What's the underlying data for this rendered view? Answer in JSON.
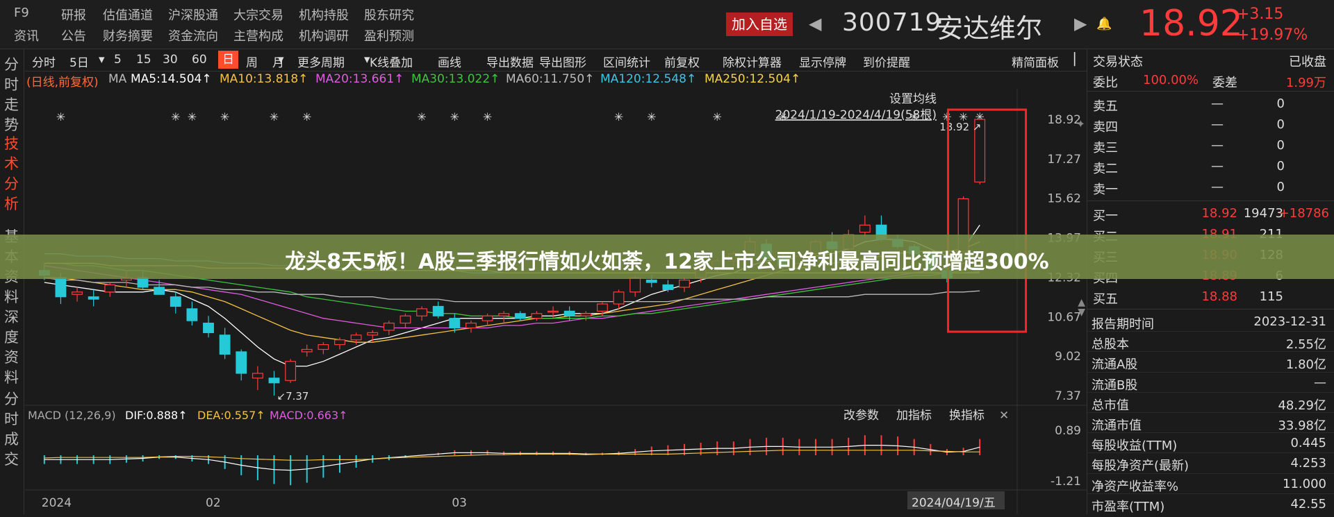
{
  "header": {
    "menu_row1": [
      "F9",
      "研报",
      "估值通道",
      "沪深股通",
      "大宗交易",
      "机构持股",
      "股东研究"
    ],
    "menu_row2": [
      "资讯",
      "公告",
      "财务摘要",
      "资金流向",
      "主营构成",
      "机构调研",
      "盈利预测"
    ],
    "add_favorite": "加入自选",
    "stock_code": "300719",
    "stock_name": "安达维尔",
    "last_price": "18.92",
    "change": "+3.15",
    "change_pct": "+19.97%"
  },
  "left_nav": [
    {
      "label": "分时走势",
      "active": false
    },
    {
      "label": "技术分析",
      "active": true
    },
    {
      "label": "基本资料",
      "active": false
    },
    {
      "label": "深度资料",
      "active": false
    },
    {
      "label": "分时成交",
      "active": false
    }
  ],
  "toolbar": {
    "periods": [
      "分时",
      "5日",
      "5",
      "15",
      "30",
      "60",
      "日",
      "周",
      "月"
    ],
    "active_period": "日",
    "tools": [
      "更多周期",
      "K线叠加",
      "画线",
      "导出数据",
      "导出图形",
      "区间统计",
      "前复权",
      "除权计算器",
      "显示停牌",
      "到价提醒"
    ],
    "layout_button": "精简面板"
  },
  "ma_line": {
    "prefix": "(日线,前复权)",
    "ma": "MA",
    "items": [
      {
        "text": "MA5:14.504↑",
        "color": "#ffffff"
      },
      {
        "text": "MA10:13.818↑",
        "color": "#f5c242"
      },
      {
        "text": "MA20:13.661↑",
        "color": "#e05ce0"
      },
      {
        "text": "MA30:13.022↑",
        "color": "#3ec43e"
      },
      {
        "text": "MA60:11.750↑",
        "color": "#bbbbbb"
      },
      {
        "text": "MA120:12.548↑",
        "color": "#39c6e6"
      },
      {
        "text": "MA250:12.504↑",
        "color": "#f5d442"
      }
    ],
    "settings_label": "设置均线",
    "range_label": "2024/1/19-2024/4/19(58根)"
  },
  "chart_data": {
    "type": "candlestick",
    "price_axis": [
      18.92,
      17.27,
      15.62,
      13.97,
      12.32,
      10.67,
      9.02,
      7.37
    ],
    "ylim": [
      7.37,
      18.92
    ],
    "high_label": "18.92",
    "low_label": "7.37",
    "ohlc": [
      [
        12.6,
        12.9,
        12.2,
        12.4
      ],
      [
        12.3,
        12.5,
        11.2,
        11.5
      ],
      [
        11.6,
        11.9,
        11.3,
        11.7
      ],
      [
        11.5,
        11.8,
        11.1,
        11.4
      ],
      [
        11.7,
        12.1,
        11.5,
        12.0
      ],
      [
        12.2,
        12.6,
        11.9,
        12.3
      ],
      [
        12.3,
        12.6,
        11.8,
        11.9
      ],
      [
        11.9,
        12.2,
        11.6,
        11.6
      ],
      [
        11.5,
        11.7,
        10.8,
        11.1
      ],
      [
        11.0,
        11.3,
        10.3,
        10.5
      ],
      [
        10.4,
        10.7,
        9.8,
        10.0
      ],
      [
        9.9,
        10.2,
        8.9,
        9.1
      ],
      [
        9.2,
        9.3,
        8.0,
        8.3
      ],
      [
        8.1,
        8.6,
        7.6,
        8.3
      ],
      [
        8.1,
        8.4,
        7.37,
        7.9
      ],
      [
        8.0,
        8.9,
        7.9,
        8.8
      ],
      [
        9.2,
        9.5,
        9.0,
        9.3
      ],
      [
        9.3,
        9.6,
        9.1,
        9.5
      ],
      [
        9.5,
        9.8,
        9.3,
        9.7
      ],
      [
        9.7,
        10.0,
        9.5,
        9.9
      ],
      [
        9.9,
        10.1,
        9.6,
        10.0
      ],
      [
        10.1,
        10.5,
        9.9,
        10.4
      ],
      [
        10.4,
        10.8,
        10.2,
        10.7
      ],
      [
        10.7,
        11.1,
        10.5,
        11.0
      ],
      [
        11.1,
        11.3,
        10.6,
        10.7
      ],
      [
        10.6,
        10.8,
        10.0,
        10.2
      ],
      [
        10.2,
        10.5,
        10.0,
        10.4
      ],
      [
        10.5,
        10.8,
        10.3,
        10.7
      ],
      [
        10.7,
        10.9,
        10.4,
        10.8
      ],
      [
        10.8,
        10.9,
        10.5,
        10.6
      ],
      [
        10.6,
        10.9,
        10.5,
        10.8
      ],
      [
        10.9,
        11.1,
        10.6,
        10.9
      ],
      [
        10.9,
        11.1,
        10.5,
        10.7
      ],
      [
        10.7,
        10.9,
        10.5,
        10.8
      ],
      [
        10.9,
        11.3,
        10.7,
        11.2
      ],
      [
        11.2,
        11.8,
        11.0,
        11.7
      ],
      [
        11.7,
        12.4,
        11.5,
        12.3
      ],
      [
        12.2,
        12.4,
        11.9,
        12.1
      ],
      [
        12.0,
        12.2,
        11.7,
        11.8
      ],
      [
        11.9,
        12.3,
        11.7,
        12.2
      ],
      [
        12.3,
        12.8,
        12.1,
        12.7
      ],
      [
        12.7,
        13.1,
        12.5,
        13.0
      ],
      [
        13.0,
        13.4,
        12.8,
        13.3
      ],
      [
        13.3,
        14.0,
        13.1,
        13.8
      ],
      [
        13.7,
        13.9,
        12.9,
        13.1
      ],
      [
        13.1,
        13.3,
        12.6,
        12.8
      ],
      [
        12.9,
        13.4,
        12.6,
        13.2
      ],
      [
        13.3,
        13.9,
        13.1,
        13.8
      ],
      [
        13.8,
        14.2,
        13.4,
        13.5
      ],
      [
        13.5,
        14.3,
        13.3,
        14.1
      ],
      [
        14.2,
        14.9,
        14.0,
        14.5
      ],
      [
        14.5,
        14.9,
        13.8,
        13.9
      ],
      [
        13.9,
        14.1,
        13.5,
        13.6
      ],
      [
        13.6,
        13.7,
        13.2,
        13.3
      ],
      [
        13.3,
        13.4,
        12.5,
        12.6
      ],
      [
        12.6,
        12.8,
        12.1,
        12.3
      ],
      [
        13.4,
        15.7,
        13.3,
        15.6
      ],
      [
        16.3,
        18.92,
        16.2,
        18.92
      ]
    ],
    "ma_series": [
      {
        "name": "MA5",
        "color": "#ffffff",
        "values": [
          12.1,
          12.0,
          11.9,
          11.8,
          11.7,
          11.7,
          11.7,
          11.8,
          11.7,
          11.4,
          11.1,
          10.6,
          10.0,
          9.4,
          8.9,
          8.6,
          8.6,
          8.8,
          9.1,
          9.4,
          9.7,
          9.8,
          10.0,
          10.2,
          10.4,
          10.6,
          10.6,
          10.6,
          10.6,
          10.6,
          10.7,
          10.7,
          10.8,
          10.8,
          10.8,
          11.0,
          11.3,
          11.6,
          11.8,
          12.0,
          12.2,
          12.4,
          12.5,
          12.8,
          13.0,
          13.1,
          13.1,
          13.2,
          13.3,
          13.5,
          13.8,
          13.9,
          13.9,
          13.8,
          13.5,
          13.2,
          13.5,
          14.5
        ]
      },
      {
        "name": "MA10",
        "color": "#f5c242",
        "values": [
          12.3,
          12.3,
          12.2,
          12.1,
          12.0,
          11.9,
          11.8,
          11.8,
          11.8,
          11.7,
          11.5,
          11.3,
          11.0,
          10.7,
          10.4,
          10.1,
          9.9,
          9.8,
          9.7,
          9.6,
          9.6,
          9.7,
          9.8,
          9.9,
          10.0,
          10.1,
          10.2,
          10.3,
          10.4,
          10.5,
          10.6,
          10.6,
          10.7,
          10.7,
          10.8,
          10.9,
          11.0,
          11.1,
          11.2,
          11.4,
          11.6,
          11.8,
          12.0,
          12.2,
          12.4,
          12.6,
          12.7,
          12.8,
          12.9,
          13.0,
          13.1,
          13.2,
          13.3,
          13.4,
          13.4,
          13.4,
          13.5,
          13.8
        ]
      },
      {
        "name": "MA20",
        "color": "#e05ce0",
        "values": [
          12.8,
          12.7,
          12.6,
          12.5,
          12.4,
          12.3,
          12.2,
          12.1,
          12.0,
          11.9,
          11.8,
          11.7,
          11.6,
          11.4,
          11.2,
          11.0,
          10.8,
          10.6,
          10.5,
          10.4,
          10.3,
          10.2,
          10.2,
          10.2,
          10.2,
          10.2,
          10.2,
          10.2,
          10.3,
          10.3,
          10.4,
          10.4,
          10.5,
          10.6,
          10.6,
          10.7,
          10.8,
          10.9,
          11.0,
          11.1,
          11.2,
          11.3,
          11.4,
          11.5,
          11.6,
          11.7,
          11.8,
          11.9,
          12.0,
          12.1,
          12.2,
          12.3,
          12.4,
          12.5,
          12.6,
          12.7,
          12.9,
          13.2
        ]
      },
      {
        "name": "MA30",
        "color": "#3ec43e",
        "values": [
          12.9,
          12.9,
          12.8,
          12.8,
          12.7,
          12.6,
          12.6,
          12.5,
          12.4,
          12.3,
          12.2,
          12.1,
          12.0,
          11.9,
          11.8,
          11.7,
          11.5,
          11.4,
          11.3,
          11.2,
          11.1,
          11.0,
          10.9,
          10.9,
          10.8,
          10.8,
          10.7,
          10.7,
          10.7,
          10.6,
          10.6,
          10.6,
          10.6,
          10.6,
          10.7,
          10.7,
          10.8,
          10.8,
          10.9,
          11.0,
          11.1,
          11.2,
          11.3,
          11.4,
          11.5,
          11.6,
          11.7,
          11.8,
          11.9,
          12.0,
          12.1,
          12.2,
          12.3,
          12.4,
          12.4,
          12.5,
          12.6,
          12.8
        ]
      },
      {
        "name": "MA60",
        "color": "#bbbbbb",
        "values": [
          12.3,
          12.2,
          12.2,
          12.1,
          12.1,
          12.1,
          12.0,
          12.0,
          12.0,
          11.9,
          11.9,
          11.8,
          11.8,
          11.7,
          11.7,
          11.6,
          11.6,
          11.6,
          11.5,
          11.5,
          11.5,
          11.4,
          11.4,
          11.4,
          11.4,
          11.3,
          11.3,
          11.3,
          11.3,
          11.3,
          11.3,
          11.3,
          11.3,
          11.3,
          11.3,
          11.3,
          11.3,
          11.3,
          11.3,
          11.4,
          11.4,
          11.4,
          11.4,
          11.4,
          11.5,
          11.5,
          11.5,
          11.5,
          11.5,
          11.5,
          11.6,
          11.6,
          11.6,
          11.6,
          11.6,
          11.7,
          11.7,
          11.75
        ]
      },
      {
        "name": "MA120",
        "color": "#39c6e6",
        "values": [
          13.3,
          13.3,
          13.2,
          13.2,
          13.2,
          13.1,
          13.1,
          13.1,
          13.0,
          13.0,
          13.0,
          12.9,
          12.9,
          12.9,
          12.8,
          12.8,
          12.8,
          12.7,
          12.7,
          12.7,
          12.7,
          12.6,
          12.6,
          12.6,
          12.6,
          12.6,
          12.5,
          12.5,
          12.5,
          12.5,
          12.5,
          12.5,
          12.5,
          12.5,
          12.5,
          12.5,
          12.5,
          12.5,
          12.5,
          12.5,
          12.5,
          12.5,
          12.5,
          12.5,
          12.5,
          12.5,
          12.5,
          12.5,
          12.5,
          12.5,
          12.5,
          12.5,
          12.5,
          12.5,
          12.5,
          12.5,
          12.5,
          12.55
        ]
      },
      {
        "name": "MA250",
        "color": "#f5d442",
        "values": [
          12.9,
          12.9,
          12.9,
          12.9,
          12.8,
          12.8,
          12.8,
          12.8,
          12.8,
          12.8,
          12.7,
          12.7,
          12.7,
          12.7,
          12.7,
          12.7,
          12.7,
          12.7,
          12.6,
          12.6,
          12.6,
          12.6,
          12.6,
          12.6,
          12.6,
          12.6,
          12.6,
          12.6,
          12.5,
          12.5,
          12.5,
          12.5,
          12.5,
          12.5,
          12.5,
          12.5,
          12.5,
          12.5,
          12.5,
          12.5,
          12.5,
          12.5,
          12.5,
          12.5,
          12.5,
          12.5,
          12.5,
          12.5,
          12.5,
          12.5,
          12.5,
          12.5,
          12.5,
          12.5,
          12.5,
          12.5,
          12.5,
          12.5
        ]
      }
    ],
    "markers": [
      1,
      8,
      9,
      11,
      14,
      16,
      23,
      25,
      27,
      35,
      37,
      41,
      45,
      53,
      55,
      56,
      57
    ],
    "x_labels": [
      {
        "index": 0,
        "text": "2024"
      },
      {
        "index": 10,
        "text": "02"
      },
      {
        "index": 25,
        "text": "03"
      }
    ],
    "x_cursor_label": "2024/04/19/五"
  },
  "macd": {
    "title": "MACD (12,26,9)",
    "dif": "DIF:0.888↑",
    "dea": "DEA:0.557↑",
    "macd": "MACD:0.663↑",
    "buttons": [
      "改参数",
      "加指标",
      "换指标"
    ],
    "axis": [
      "0.89",
      "-1.21"
    ]
  },
  "right_panel": {
    "title": "交易状态",
    "status": "已收盘",
    "weibi_label": "委比",
    "weibi_value": "100.00%",
    "weicha_label": "委差",
    "weicha_value": "1.99万",
    "asks": [
      {
        "label": "卖五",
        "price": "—",
        "vol": "0"
      },
      {
        "label": "卖四",
        "price": "—",
        "vol": "0"
      },
      {
        "label": "卖三",
        "price": "—",
        "vol": "0"
      },
      {
        "label": "卖二",
        "price": "—",
        "vol": "0"
      },
      {
        "label": "卖一",
        "price": "—",
        "vol": "0"
      }
    ],
    "bids": [
      {
        "label": "买一",
        "price": "18.92",
        "vol": "19473",
        "delta": "+18786"
      },
      {
        "label": "买二",
        "price": "18.91",
        "vol": "211",
        "delta": ""
      },
      {
        "label": "买三",
        "price": "18.90",
        "vol": "128",
        "delta": ""
      },
      {
        "label": "买四",
        "price": "18.89",
        "vol": "6",
        "delta": ""
      },
      {
        "label": "买五",
        "price": "18.88",
        "vol": "115",
        "delta": ""
      }
    ],
    "fundamentals": [
      {
        "label": "报告期时间",
        "value": "2023-12-31"
      },
      {
        "label": "总股本",
        "value": "2.55亿"
      },
      {
        "label": "流通A股",
        "value": "1.80亿"
      },
      {
        "label": "流通B股",
        "value": "—"
      },
      {
        "label": "总市值",
        "value": "48.29亿"
      },
      {
        "label": "流通市值",
        "value": "33.98亿"
      },
      {
        "label": "每股收益(TTM)",
        "value": "0.445"
      },
      {
        "label": "每股净资产(最新)",
        "value": "4.253"
      },
      {
        "label": "净资产收益率%",
        "value": "11.000"
      },
      {
        "label": "市盈率(TTM)",
        "value": "42.55"
      }
    ]
  },
  "banner": {
    "text": "龙头8天5板！A股三季报行情如火如荼，12家上市公司净利最高同比预增超300%"
  }
}
